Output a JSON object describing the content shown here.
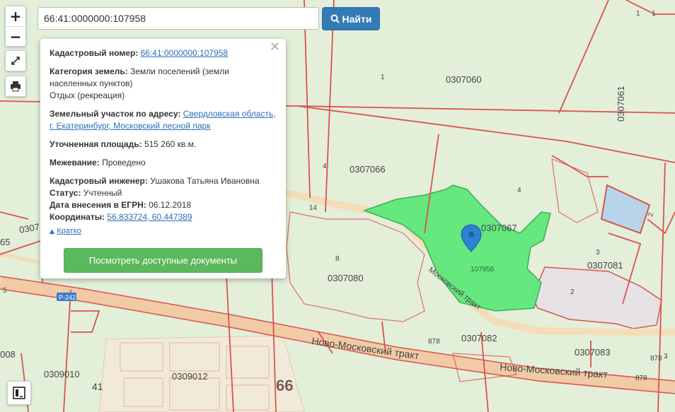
{
  "search": {
    "value": "66:41:0000000:107958"
  },
  "find_button": {
    "label": "Найти"
  },
  "controls": {
    "zoom_in": "+",
    "zoom_out": "−"
  },
  "popup": {
    "cadastral_label": "Кадастровый номер:",
    "cadastral_value": "66:41:0000000:107958",
    "category_label": "Категория земель:",
    "category_value": "Земли поселений (земли населенных пунктов)",
    "category_use": "Отдых (рекреация)",
    "address_label": "Земельный участок по адресу:",
    "address_value": "Свердловская область, г. Екатеринбург, Московский лесной парк",
    "area_label": "Уточненная площадь:",
    "area_value": "515 260 кв.м.",
    "survey_label": "Межевание:",
    "survey_value": "Проведено",
    "engineer_label": "Кадастровый инженер:",
    "engineer_value": "Ушакова Татьяна Ивановна",
    "status_label": "Статус:",
    "status_value": "Учтенный",
    "date_label": "Дата внесения в ЕГРН:",
    "date_value": "06.12.2018",
    "coords_label": "Координаты:",
    "coords_value": "56.833724, 60.447389",
    "short_link": "Кратко",
    "docs_button": "Посмотреть доступные документы"
  },
  "map": {
    "quarters": [
      "0307060",
      "0307061",
      "0307066",
      "0307067",
      "0307081",
      "0307080",
      "0307082",
      "0307083",
      "0309010",
      "0309012"
    ],
    "parcel_label": "107958",
    "small_labels": [
      "1",
      "1",
      "1",
      "4",
      "4",
      "3",
      "2",
      "2",
      "8",
      "14",
      "878",
      "878",
      "878",
      "3"
    ],
    "district": [
      "41",
      "66"
    ],
    "roads": [
      "Ново-Московский тракт",
      "Ново-Московский тракт",
      "Московский тракт",
      "Р-242"
    ],
    "edge_labels": [
      "0307",
      "65",
      "008",
      "5",
      "41"
    ]
  },
  "colors": {
    "boundary": "#d9534f",
    "parcel": "#5fe87a",
    "water": "#b7d4ea",
    "road": "#f0c9a0",
    "map_bg": "#e3efd9"
  }
}
